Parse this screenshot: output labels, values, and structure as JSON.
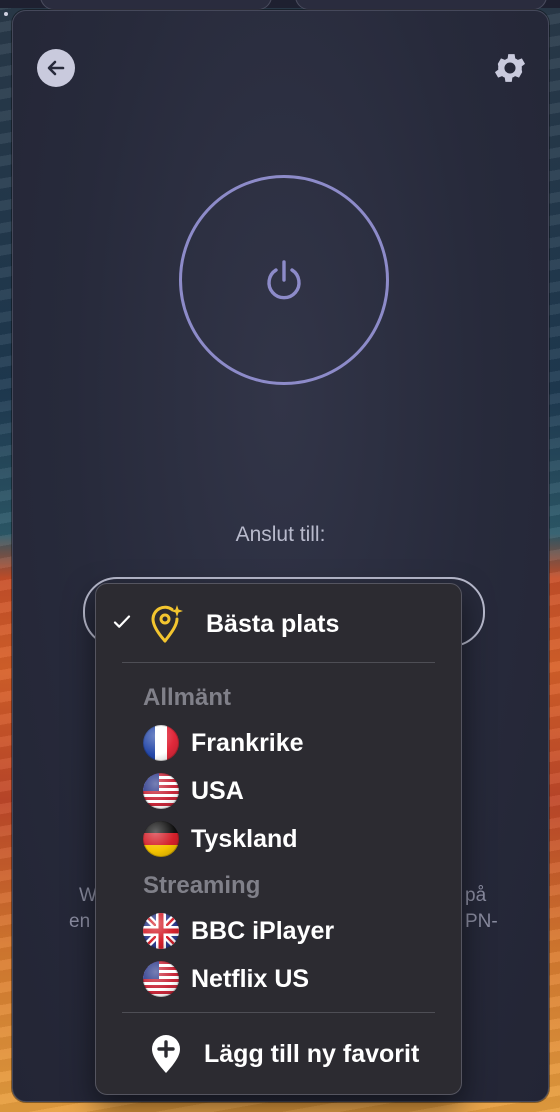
{
  "window": {
    "connect_label": "Anslut till:",
    "bg_text_left_1": "W",
    "bg_text_left_2": "en",
    "bg_text_right_1": "på",
    "bg_text_right_2": "PN-"
  },
  "menu": {
    "best_location": {
      "label": "Bästa plats",
      "checked": true,
      "icon": "location-sparkle-icon"
    },
    "sections": [
      {
        "label": "Allmänt",
        "items": [
          {
            "label": "Frankrike",
            "flag": "france-flag-icon"
          },
          {
            "label": "USA",
            "flag": "usa-flag-icon"
          },
          {
            "label": "Tyskland",
            "flag": "germany-flag-icon"
          }
        ]
      },
      {
        "label": "Streaming",
        "items": [
          {
            "label": "BBC iPlayer",
            "flag": "uk-flag-icon"
          },
          {
            "label": "Netflix US",
            "flag": "usa-flag-icon"
          }
        ]
      }
    ],
    "add_favorite": {
      "label": "Lägg till ny favorit",
      "icon": "add-location-icon"
    }
  },
  "colors": {
    "accent_ring": "#8d8bc9",
    "pin_yellow": "#f3c52f",
    "menu_bg": "#2c2b31"
  }
}
